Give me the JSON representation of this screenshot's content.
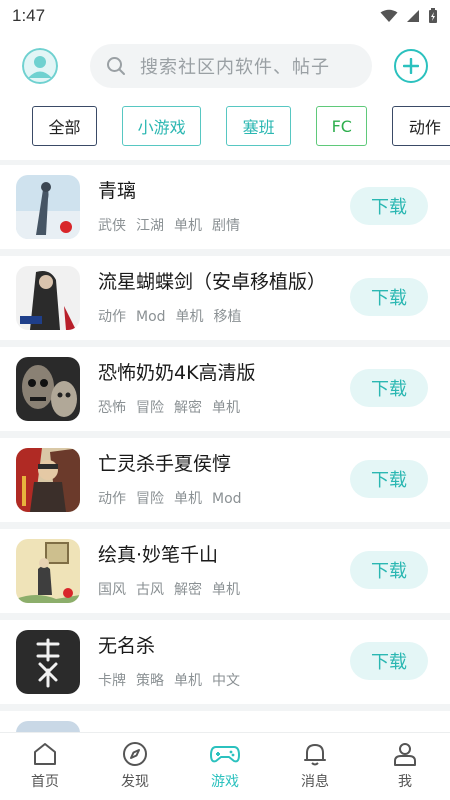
{
  "status": {
    "time": "1:47"
  },
  "header": {
    "search_placeholder": "搜索社区内软件、帖子"
  },
  "chips": [
    {
      "label": "全部"
    },
    {
      "label": "小游戏"
    },
    {
      "label": "塞班"
    },
    {
      "label": "FC"
    },
    {
      "label": "动作"
    }
  ],
  "download_label": "下载",
  "games": [
    {
      "title": "青璃",
      "tags": [
        "武侠",
        "江湖",
        "单机",
        "剧情"
      ]
    },
    {
      "title": "流星蝴蝶剑（安卓移植版）",
      "tags": [
        "动作",
        "Mod",
        "单机",
        "移植"
      ]
    },
    {
      "title": "恐怖奶奶4K高清版",
      "tags": [
        "恐怖",
        "冒险",
        "解密",
        "单机"
      ]
    },
    {
      "title": "亡灵杀手夏侯惇",
      "tags": [
        "动作",
        "冒险",
        "单机",
        "Mod"
      ]
    },
    {
      "title": "绘真·妙笔千山",
      "tags": [
        "国风",
        "古风",
        "解密",
        "单机"
      ]
    },
    {
      "title": "无名杀",
      "tags": [
        "卡牌",
        "策略",
        "单机",
        "中文"
      ]
    }
  ],
  "nav": [
    {
      "label": "首页",
      "icon": "home-icon"
    },
    {
      "label": "发现",
      "icon": "compass-icon"
    },
    {
      "label": "游戏",
      "icon": "gamepad-icon",
      "active": true
    },
    {
      "label": "消息",
      "icon": "bell-icon"
    },
    {
      "label": "我",
      "icon": "user-icon"
    }
  ],
  "colors": {
    "accent": "#2bc1be",
    "download_bg": "#e4f6f6",
    "list_bg": "#f2f4f5"
  }
}
